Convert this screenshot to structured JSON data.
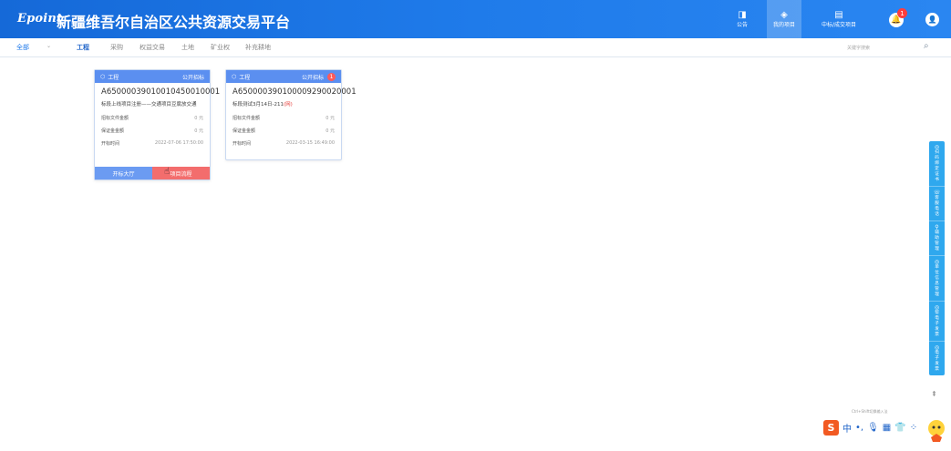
{
  "header": {
    "logo": "Epoint",
    "title": "新疆维吾尔自治区公共资源交易平台",
    "nav": [
      {
        "icon": "announcement-icon",
        "glyph": "◨",
        "label": "公告"
      },
      {
        "icon": "my-projects-icon",
        "glyph": "◈",
        "label": "我的项目"
      },
      {
        "icon": "winning-projects-icon",
        "glyph": "▤",
        "label": "中标/成交项目"
      }
    ],
    "bell_glyph": "🔔",
    "bell_badge": "1",
    "user_glyph": "👤"
  },
  "filter": {
    "select_value": "全部",
    "tabs": [
      "工程",
      "采购",
      "权益交易",
      "土地",
      "矿业权",
      "补充耕地"
    ],
    "search_placeholder": "关键字搜索"
  },
  "cards": [
    {
      "type": "工程",
      "method": "公开招标",
      "badge": "",
      "code": "A65000039010010450010001",
      "name_main": "标段上线项目注册——交通项目豆腐放交通",
      "name_tag": "",
      "rows": [
        {
          "label": "招标文件金额",
          "value": "0 元"
        },
        {
          "label": "保证金金额",
          "value": "0 元"
        },
        {
          "label": "开标时间",
          "value": "2022-07-06 17:50:00"
        }
      ],
      "btn_left": "开标大厅",
      "btn_right": "项目流程"
    },
    {
      "type": "工程",
      "method": "公开招标",
      "badge": "1",
      "code": "A650000390100009290020001",
      "name_main": "标段测试3月14日-211",
      "name_tag": "(网)",
      "rows": [
        {
          "label": "招标文件金额",
          "value": "0 元"
        },
        {
          "label": "保证金金额",
          "value": "0 元"
        },
        {
          "label": "开标时间",
          "value": "2022-03-15 16:49:00"
        }
      ]
    }
  ],
  "side_tools": [
    {
      "glyph": "◎",
      "label": "扫码绑定证书"
    },
    {
      "glyph": "☏",
      "label": "客服电话"
    },
    {
      "glyph": "⚲",
      "label": "辅助管理"
    },
    {
      "glyph": "◎",
      "label": "单位信息管理"
    },
    {
      "glyph": "◎",
      "label": "帮电子发票"
    },
    {
      "glyph": "◎",
      "label": "电子发票"
    }
  ],
  "to_top": "⇞",
  "ime": {
    "logo": "S",
    "items": [
      "中",
      "•,",
      "🎙",
      "▦",
      "👕",
      "⁘"
    ],
    "hint": "Ctrl+Shift切换输入法"
  }
}
